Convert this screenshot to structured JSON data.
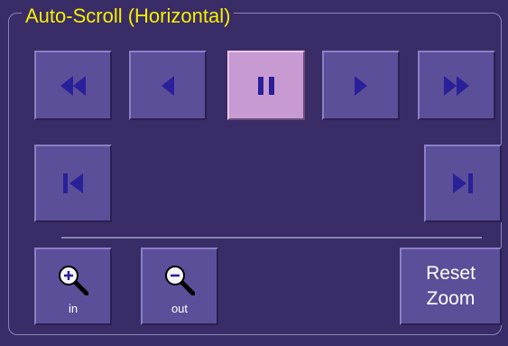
{
  "panel": {
    "title": "Auto-Scroll (Horizontal)"
  },
  "controls": {
    "fast_rewind_icon": "fast-rewind-icon",
    "step_back_icon": "step-back-icon",
    "pause_icon": "pause-icon",
    "step_forward_icon": "step-forward-icon",
    "fast_forward_icon": "fast-forward-icon",
    "go_to_start_icon": "skip-to-start-icon",
    "go_to_end_icon": "skip-to-end-icon",
    "active": "pause"
  },
  "zoom": {
    "in_label": "in",
    "out_label": "out",
    "reset_label": "Reset\nZoom"
  },
  "colors": {
    "background": "#3a2c66",
    "button": "#5b4f9a",
    "active_button": "#c79bd1",
    "icon": "#2a2099",
    "title": "#f4f000"
  }
}
